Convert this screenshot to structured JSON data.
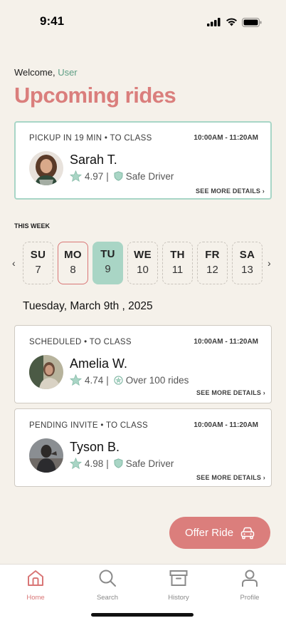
{
  "status_bar": {
    "time": "9:41"
  },
  "header": {
    "welcome_prefix": "Welcome,",
    "user_name": "User",
    "title": "Upcoming rides"
  },
  "next_ride": {
    "status": "PICKUP IN 19 MIN • TO CLASS",
    "time": "10:00AM - 11:20AM",
    "driver_name": "Sarah T.",
    "rating": "4.97",
    "separator": "|",
    "badge": "Safe Driver",
    "see_more": "SEE MORE DETAILS ›"
  },
  "week": {
    "label": "THIS WEEK",
    "prev": "‹",
    "next": "›",
    "days": [
      {
        "name": "SU",
        "num": "7"
      },
      {
        "name": "MO",
        "num": "8"
      },
      {
        "name": "TU",
        "num": "9"
      },
      {
        "name": "WE",
        "num": "10"
      },
      {
        "name": "TH",
        "num": "11"
      },
      {
        "name": "FR",
        "num": "12"
      },
      {
        "name": "SA",
        "num": "13"
      }
    ]
  },
  "selected_date": "Tuesday, March 9th , 2025",
  "rides": [
    {
      "status": "SCHEDULED • TO CLASS",
      "time": "10:00AM - 11:20AM",
      "driver_name": "Amelia W.",
      "rating": "4.74",
      "separator": "|",
      "badge": "Over 100 rides",
      "see_more": "SEE MORE DETAILS ›"
    },
    {
      "status": "PENDING INVITE • TO CLASS",
      "time": "10:00AM - 11:20AM",
      "driver_name": "Tyson B.",
      "rating": "4.98",
      "separator": "|",
      "badge": "Safe Driver",
      "see_more": "SEE MORE DETAILS ›"
    }
  ],
  "offer_button": {
    "label": "Offer Ride",
    "icon": "car-icon"
  },
  "tabs": [
    {
      "label": "Home",
      "icon": "home-icon"
    },
    {
      "label": "Search",
      "icon": "search-icon"
    },
    {
      "label": "History",
      "icon": "archive-icon"
    },
    {
      "label": "Profile",
      "icon": "user-icon"
    }
  ],
  "colors": {
    "accent_coral": "#db7e7c",
    "accent_mint": "#a9d5c5",
    "user_green": "#5e9e85",
    "background": "#f5f1ea"
  }
}
